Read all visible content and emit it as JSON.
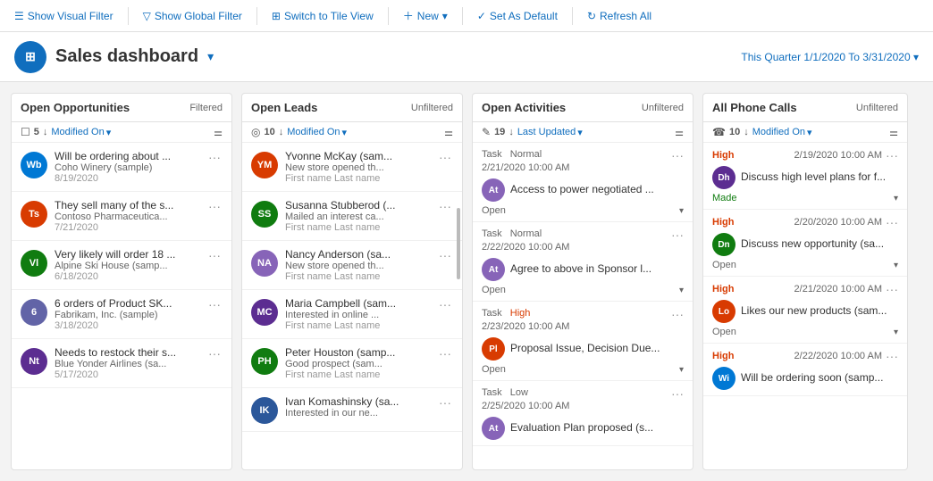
{
  "toolbar": {
    "show_visual_filter": "Show Visual Filter",
    "show_global_filter": "Show Global Filter",
    "switch_tile_view": "Switch to Tile View",
    "new": "New",
    "set_as_default": "Set As Default",
    "refresh_all": "Refresh All"
  },
  "header": {
    "title": "Sales dashboard",
    "date_range": "This Quarter 1/1/2020 To 3/31/2020"
  },
  "columns": {
    "open_opportunities": {
      "title": "Open Opportunities",
      "badge": "Filtered",
      "count": "5",
      "sort": "Modified On",
      "items": [
        {
          "initials": "Wb",
          "color": "#0078d4",
          "title": "Will be ordering about ...",
          "sub": "Coho Winery (sample)",
          "date": "8/19/2020"
        },
        {
          "initials": "Ts",
          "color": "#d83b01",
          "title": "They sell many of the s...",
          "sub": "Contoso Pharmaceutica...",
          "date": "7/21/2020"
        },
        {
          "initials": "Vl",
          "color": "#107c10",
          "title": "Very likely will order 18 ...",
          "sub": "Alpine Ski House (samp...",
          "date": "6/18/2020"
        },
        {
          "initials": "6",
          "color": "#6264a7",
          "title": "6 orders of Product SK...",
          "sub": "Fabrikam, Inc. (sample)",
          "date": "3/18/2020"
        },
        {
          "initials": "Nt",
          "color": "#5c2d91",
          "title": "Needs to restock their s...",
          "sub": "Blue Yonder Airlines (sa...",
          "date": "5/17/2020"
        }
      ]
    },
    "open_leads": {
      "title": "Open Leads",
      "badge": "Unfiltered",
      "count": "10",
      "sort": "Modified On",
      "items": [
        {
          "initials": "YM",
          "color": "#d83b01",
          "title": "Yvonne McKay (sam...",
          "sub": "New store opened th...",
          "sub2": "First name Last name"
        },
        {
          "initials": "SS",
          "color": "#107c10",
          "title": "Susanna Stubberod (...",
          "sub": "Mailed an interest ca...",
          "sub2": "First name Last name"
        },
        {
          "initials": "NA",
          "color": "#8764b8",
          "title": "Nancy Anderson (sa...",
          "sub": "New store opened th...",
          "sub2": "First name Last name"
        },
        {
          "initials": "MC",
          "color": "#5c2d91",
          "title": "Maria Campbell (sam...",
          "sub": "Interested in online ...",
          "sub2": "First name Last name"
        },
        {
          "initials": "PH",
          "color": "#107c10",
          "title": "Peter Houston (samp...",
          "sub": "Good prospect (sam...",
          "sub2": "First name Last name"
        },
        {
          "initials": "IK",
          "color": "#2b579a",
          "title": "Ivan Komashinsky (sa...",
          "sub": "Interested in our ne...",
          "sub2": ""
        }
      ]
    },
    "open_activities": {
      "title": "Open Activities",
      "badge": "Unfiltered",
      "count": "19",
      "sort": "Last Updated",
      "items": [
        {
          "type": "Task",
          "priority": "Normal",
          "date": "2/21/2020 10:00 AM",
          "initials": "At",
          "color": "#8764b8",
          "title": "Access to power negotiated ...",
          "status": "Open"
        },
        {
          "type": "Task",
          "priority": "Normal",
          "date": "2/22/2020 10:00 AM",
          "initials": "At",
          "color": "#8764b8",
          "title": "Agree to above in Sponsor l...",
          "status": "Open"
        },
        {
          "type": "Task",
          "priority": "High",
          "date": "2/23/2020 10:00 AM",
          "initials": "Pl",
          "color": "#d83b01",
          "title": "Proposal Issue, Decision Due...",
          "status": "Open"
        },
        {
          "type": "Task",
          "priority": "Low",
          "date": "2/25/2020 10:00 AM",
          "initials": "At",
          "color": "#8764b8",
          "title": "Evaluation Plan proposed (s...",
          "status": ""
        }
      ]
    },
    "all_phone_calls": {
      "title": "All Phone Calls",
      "badge": "Unfiltered",
      "count": "10",
      "sort": "Modified On",
      "items": [
        {
          "priority": "High",
          "date": "2/19/2020 10:00 AM",
          "initials": "Dh",
          "color": "#5c2d91",
          "title": "Discuss high level plans for f...",
          "status": "Made"
        },
        {
          "priority": "High",
          "date": "2/20/2020 10:00 AM",
          "initials": "Dn",
          "color": "#107c10",
          "title": "Discuss new opportunity (sa...",
          "status": "Open"
        },
        {
          "priority": "High",
          "date": "2/21/2020 10:00 AM",
          "initials": "Lo",
          "color": "#d83b01",
          "title": "Likes our new products (sam...",
          "status": "Open"
        },
        {
          "priority": "High",
          "date": "2/22/2020 10:00 AM",
          "initials": "Wi",
          "color": "#0078d4",
          "title": "Will be ordering soon (samp...",
          "status": ""
        }
      ]
    }
  }
}
